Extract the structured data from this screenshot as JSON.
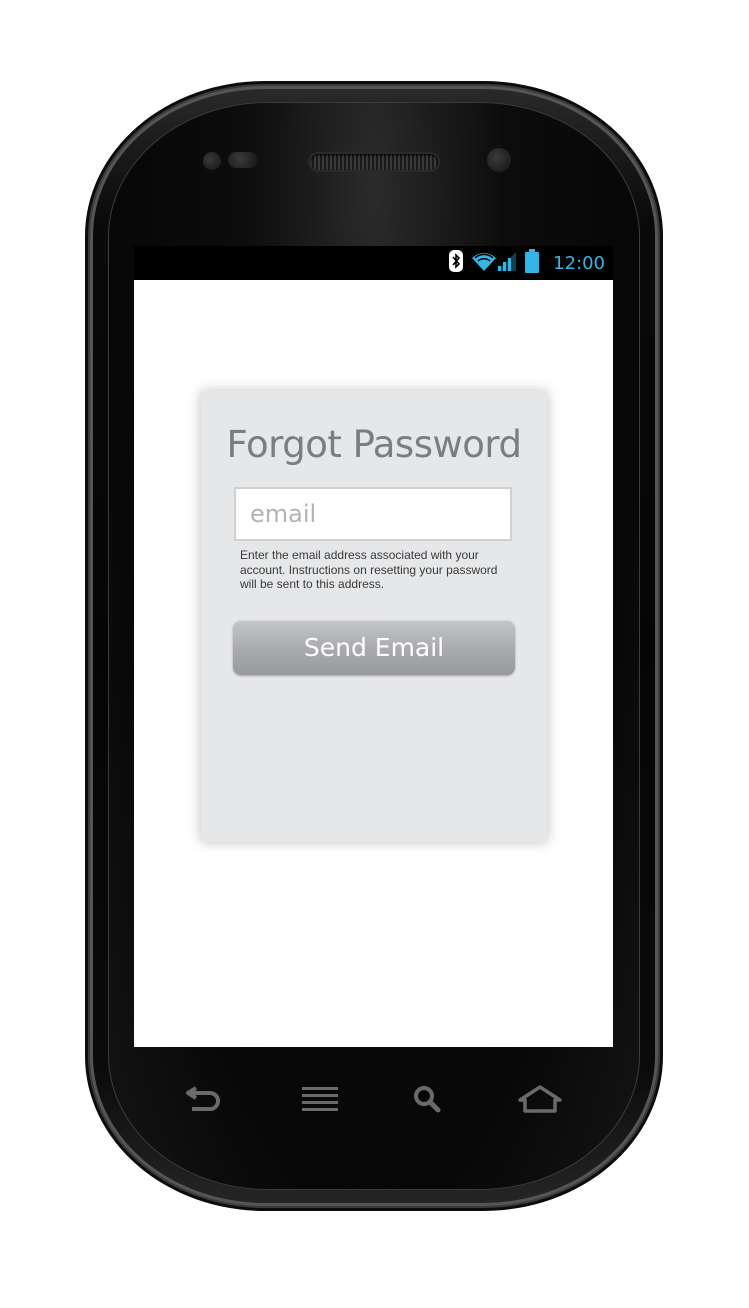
{
  "status_bar": {
    "time": "12:00",
    "icons": [
      "bluetooth-icon",
      "wifi-icon",
      "signal-icon",
      "battery-icon"
    ],
    "accent_color": "#33b5e5"
  },
  "forgot_password": {
    "title": "Forgot Password",
    "email_placeholder": "email",
    "email_value": "",
    "help_text": "Enter the email address associated with your account. Instructions on resetting your password will be sent to this address.",
    "send_button_label": "Send Email"
  },
  "nav_bar": {
    "buttons": [
      "back-icon",
      "menu-icon",
      "search-icon",
      "home-icon"
    ]
  }
}
